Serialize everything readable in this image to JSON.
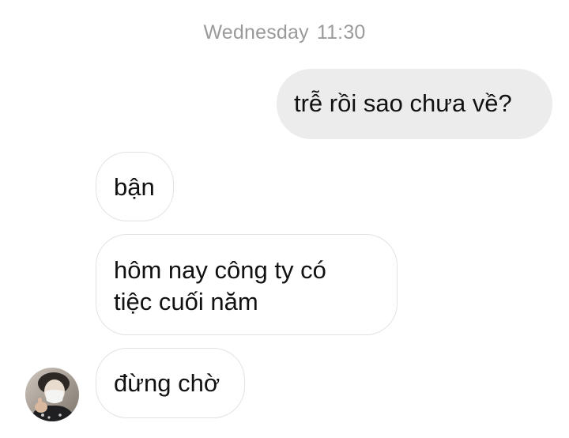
{
  "conversation": {
    "timestamp_day": "Wednesday",
    "timestamp_time": "11:30"
  },
  "messages": [
    {
      "direction": "sent",
      "text": "trễ rồi sao chưa về?"
    },
    {
      "direction": "received",
      "text": "bận"
    },
    {
      "direction": "received",
      "lines": [
        "hôm nay công ty có",
        "tiệc cuối năm"
      ]
    },
    {
      "direction": "received",
      "text": "đừng chờ"
    }
  ],
  "contact": {
    "avatar_icon": "contact-avatar-photo"
  },
  "colors": {
    "sent_bubble": "#ececec",
    "received_border": "#e2e2e2",
    "timestamp_text": "#9a9a9a"
  }
}
